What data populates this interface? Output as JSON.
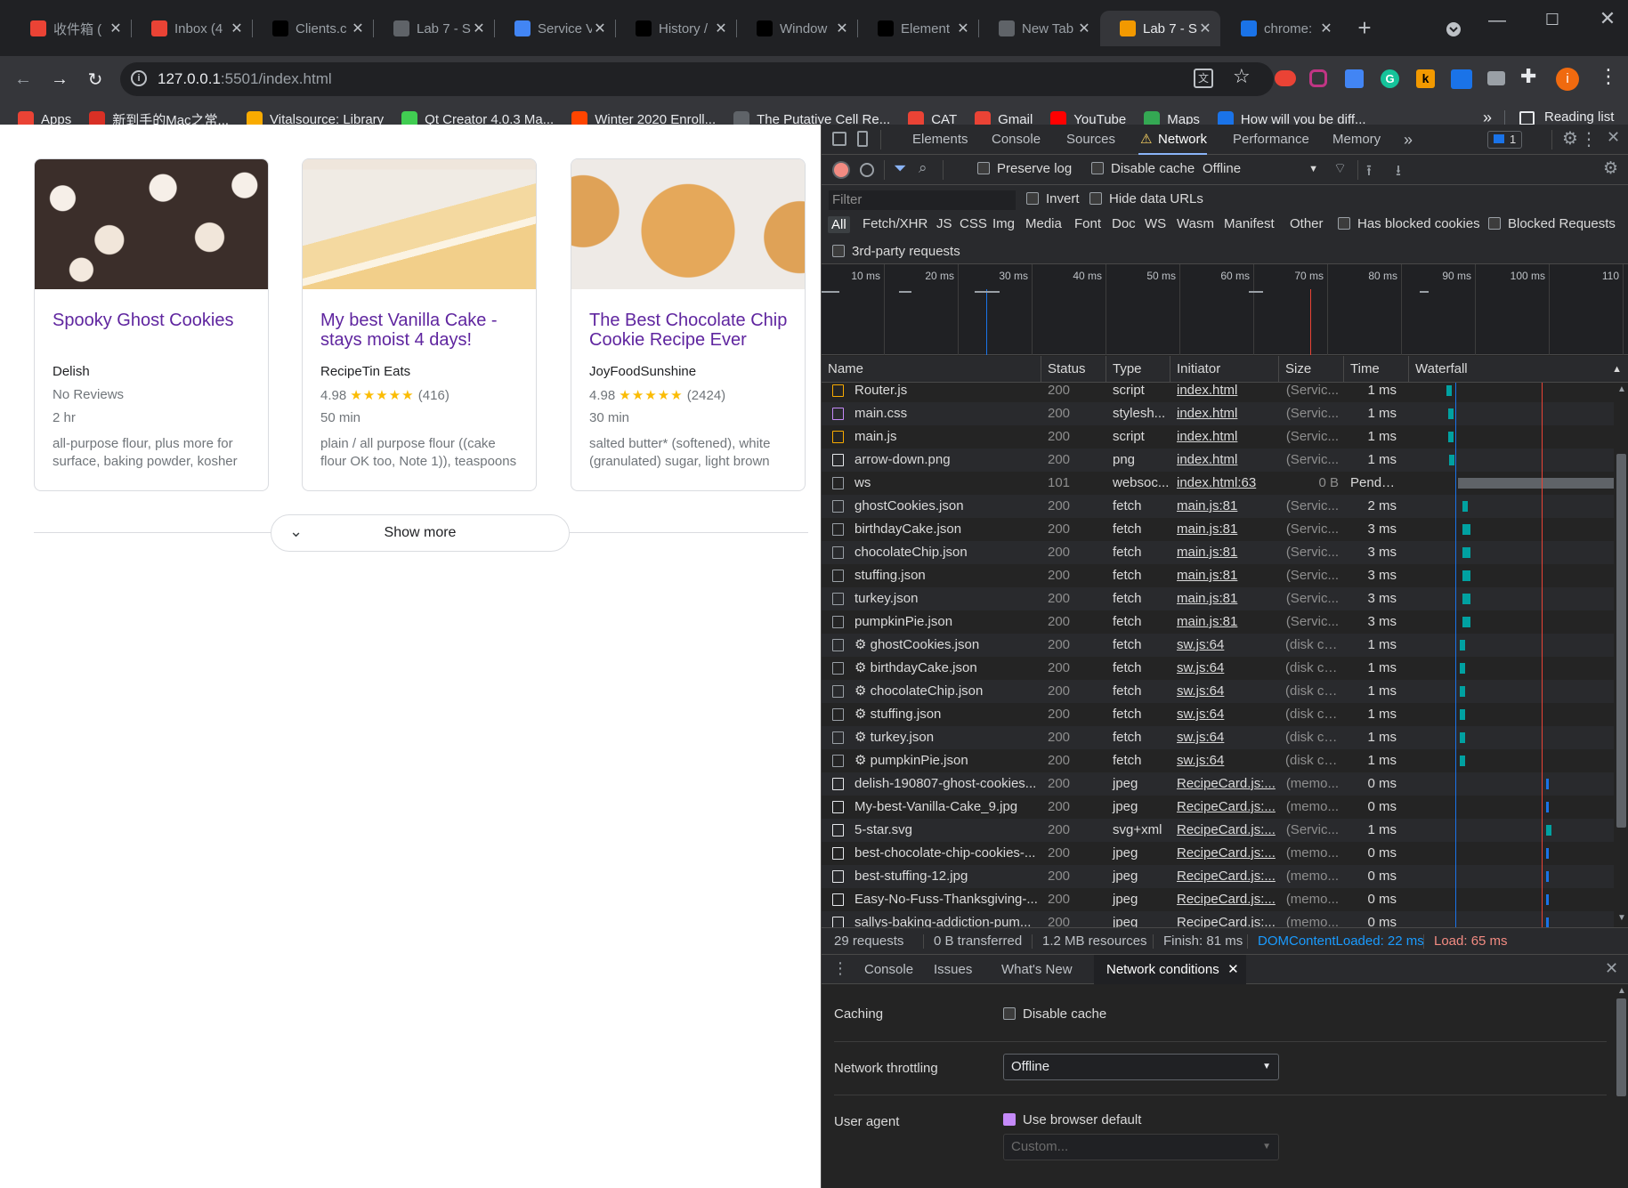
{
  "tabs": [
    {
      "title": "收件箱 (",
      "icon": "gmail-icon",
      "color": "#ea4335"
    },
    {
      "title": "Inbox (4",
      "icon": "gmail-icon",
      "color": "#ea4335"
    },
    {
      "title": "Clients.c",
      "icon": "notion-icon",
      "color": "#000000"
    },
    {
      "title": "Lab 7 - S",
      "icon": "globe-icon",
      "color": "#5f6368"
    },
    {
      "title": "Service V",
      "icon": "google-slides-icon",
      "color": "#4285f4"
    },
    {
      "title": "History /",
      "icon": "notion-icon",
      "color": "#000000"
    },
    {
      "title": "Window",
      "icon": "notion-icon",
      "color": "#000000"
    },
    {
      "title": "Element",
      "icon": "notion-icon",
      "color": "#000000"
    },
    {
      "title": "New Tab",
      "icon": "chrome-icon",
      "color": "#5f6368"
    },
    {
      "title": "Lab 7 - S",
      "icon": "cookie-icon",
      "color": "#f29900",
      "active": true
    },
    {
      "title": "chrome:",
      "icon": "chrome-icon",
      "color": "#1a73e8"
    }
  ],
  "url": {
    "host": "127.0.0.1",
    "rest": ":5501/index.html"
  },
  "bookmarks": [
    {
      "label": "Apps",
      "color": "#ea4335"
    },
    {
      "label": "新到手的Mac之常...",
      "color": "#d93025"
    },
    {
      "label": "Vitalsource: Library",
      "color": "#f9ab00"
    },
    {
      "label": "Qt Creator 4.0.3 Ma...",
      "color": "#41cd52"
    },
    {
      "label": "Winter 2020 Enroll...",
      "color": "#ff4500"
    },
    {
      "label": "The Putative Cell Re...",
      "color": "#5f6368"
    },
    {
      "label": "CAT",
      "color": "#ea4335"
    },
    {
      "label": "Gmail",
      "color": "#ea4335"
    },
    {
      "label": "YouTube",
      "color": "#ff0000"
    },
    {
      "label": "Maps",
      "color": "#34a853"
    },
    {
      "label": "How will you be diff...",
      "color": "#1a73e8"
    }
  ],
  "reading_list": "Reading list",
  "more_bookmarks": "»",
  "cards": [
    {
      "title": "Spooky Ghost Cookies",
      "source": "Delish",
      "rating": "No Reviews",
      "stars": "",
      "count": "",
      "time": "2 hr",
      "ingredients": "all-purpose flour, plus more for surface, baking powder, kosher"
    },
    {
      "title": "My best Vanilla Cake - stays moist 4 days!",
      "source": "RecipeTin Eats",
      "rating": "4.98",
      "stars": "★★★★★",
      "count": "(416)",
      "time": "50 min",
      "ingredients": "plain / all purpose flour ((cake flour OK too, Note 1)), teaspoons"
    },
    {
      "title": "The Best Chocolate Chip Cookie Recipe Ever",
      "source": "JoyFoodSunshine",
      "rating": "4.98",
      "stars": "★★★★★",
      "count": "(2424)",
      "time": "30 min",
      "ingredients": "salted butter* (softened), white (granulated) sugar, light brown"
    }
  ],
  "show_more": "Show more",
  "devtools": {
    "tabs": [
      "Elements",
      "Console",
      "Sources",
      "Network",
      "Performance",
      "Memory"
    ],
    "issues_count": "1",
    "toolbar": {
      "preserve_log": "Preserve log",
      "disable_cache": "Disable cache",
      "throttle": "Offline"
    },
    "filter_placeholder": "Filter",
    "invert": "Invert",
    "hide_data_urls": "Hide data URLs",
    "types": [
      "All",
      "Fetch/XHR",
      "JS",
      "CSS",
      "Img",
      "Media",
      "Font",
      "Doc",
      "WS",
      "Wasm",
      "Manifest",
      "Other"
    ],
    "has_blocked_cookies": "Has blocked cookies",
    "blocked_requests": "Blocked Requests",
    "third_party": "3rd-party requests",
    "ticks": [
      "10 ms",
      "20 ms",
      "30 ms",
      "40 ms",
      "50 ms",
      "60 ms",
      "70 ms",
      "80 ms",
      "90 ms",
      "100 ms",
      "110"
    ],
    "columns": [
      "Name",
      "Status",
      "Type",
      "Initiator",
      "Size",
      "Time",
      "Waterfall"
    ],
    "rows": [
      {
        "name": "Router.js",
        "status": "200",
        "type": "script",
        "init": "index.html",
        "size": "(Servic...",
        "time": "1 ms",
        "icon": "script-icon",
        "wf": 0.05
      },
      {
        "name": "main.css",
        "status": "200",
        "type": "stylesh...",
        "init": "index.html",
        "size": "(Servic...",
        "time": "1 ms",
        "icon": "css-icon",
        "wf": 0.055
      },
      {
        "name": "main.js",
        "status": "200",
        "type": "script",
        "init": "index.html",
        "size": "(Servic...",
        "time": "1 ms",
        "icon": "script-icon",
        "wf": 0.055
      },
      {
        "name": "arrow-down.png",
        "status": "200",
        "type": "png",
        "init": "index.html",
        "size": "(Servic...",
        "time": "1 ms",
        "icon": "image-icon",
        "wf": 0.06
      },
      {
        "name": "ws",
        "status": "101",
        "type": "websoc...",
        "init": "index.html:63",
        "size": "0 B",
        "time": "Pending",
        "icon": "file-icon",
        "wf": 0.1
      },
      {
        "name": "ghostCookies.json",
        "status": "200",
        "type": "fetch",
        "init": "main.js:81",
        "size": "(Servic...",
        "time": "2 ms",
        "icon": "file-icon",
        "wf": 0.12
      },
      {
        "name": "birthdayCake.json",
        "status": "200",
        "type": "fetch",
        "init": "main.js:81",
        "size": "(Servic...",
        "time": "3 ms",
        "icon": "file-icon",
        "wf": 0.12
      },
      {
        "name": "chocolateChip.json",
        "status": "200",
        "type": "fetch",
        "init": "main.js:81",
        "size": "(Servic...",
        "time": "3 ms",
        "icon": "file-icon",
        "wf": 0.12
      },
      {
        "name": "stuffing.json",
        "status": "200",
        "type": "fetch",
        "init": "main.js:81",
        "size": "(Servic...",
        "time": "3 ms",
        "icon": "file-icon",
        "wf": 0.12
      },
      {
        "name": "turkey.json",
        "status": "200",
        "type": "fetch",
        "init": "main.js:81",
        "size": "(Servic...",
        "time": "3 ms",
        "icon": "file-icon",
        "wf": 0.12
      },
      {
        "name": "pumpkinPie.json",
        "status": "200",
        "type": "fetch",
        "init": "main.js:81",
        "size": "(Servic...",
        "time": "3 ms",
        "icon": "file-icon",
        "wf": 0.12
      },
      {
        "name": "⚙ ghostCookies.json",
        "status": "200",
        "type": "fetch",
        "init": "sw.js:64",
        "size": "(disk ca...",
        "time": "1 ms",
        "icon": "file-icon",
        "wf": 0.11
      },
      {
        "name": "⚙ birthdayCake.json",
        "status": "200",
        "type": "fetch",
        "init": "sw.js:64",
        "size": "(disk ca...",
        "time": "1 ms",
        "icon": "file-icon",
        "wf": 0.11
      },
      {
        "name": "⚙ chocolateChip.json",
        "status": "200",
        "type": "fetch",
        "init": "sw.js:64",
        "size": "(disk ca...",
        "time": "1 ms",
        "icon": "file-icon",
        "wf": 0.11
      },
      {
        "name": "⚙ stuffing.json",
        "status": "200",
        "type": "fetch",
        "init": "sw.js:64",
        "size": "(disk ca...",
        "time": "1 ms",
        "icon": "file-icon",
        "wf": 0.11
      },
      {
        "name": "⚙ turkey.json",
        "status": "200",
        "type": "fetch",
        "init": "sw.js:64",
        "size": "(disk ca...",
        "time": "1 ms",
        "icon": "file-icon",
        "wf": 0.11
      },
      {
        "name": "⚙ pumpkinPie.json",
        "status": "200",
        "type": "fetch",
        "init": "sw.js:64",
        "size": "(disk ca...",
        "time": "1 ms",
        "icon": "file-icon",
        "wf": 0.11
      },
      {
        "name": "delish-190807-ghost-cookies...",
        "status": "200",
        "type": "jpeg",
        "init": "RecipeCard.js:...",
        "size": "(memo...",
        "time": "0 ms",
        "icon": "image-icon",
        "wf": 0.5
      },
      {
        "name": "My-best-Vanilla-Cake_9.jpg",
        "status": "200",
        "type": "jpeg",
        "init": "RecipeCard.js:...",
        "size": "(memo...",
        "time": "0 ms",
        "icon": "image-icon",
        "wf": 0.5
      },
      {
        "name": "5-star.svg",
        "status": "200",
        "type": "svg+xml",
        "init": "RecipeCard.js:...",
        "size": "(Servic...",
        "time": "1 ms",
        "icon": "image-icon",
        "wf": 0.5
      },
      {
        "name": "best-chocolate-chip-cookies-...",
        "status": "200",
        "type": "jpeg",
        "init": "RecipeCard.js:...",
        "size": "(memo...",
        "time": "0 ms",
        "icon": "image-icon",
        "wf": 0.5
      },
      {
        "name": "best-stuffing-12.jpg",
        "status": "200",
        "type": "jpeg",
        "init": "RecipeCard.js:...",
        "size": "(memo...",
        "time": "0 ms",
        "icon": "image-icon",
        "wf": 0.5
      },
      {
        "name": "Easy-No-Fuss-Thanksgiving-...",
        "status": "200",
        "type": "jpeg",
        "init": "RecipeCard.js:...",
        "size": "(memo...",
        "time": "0 ms",
        "icon": "image-icon",
        "wf": 0.5
      },
      {
        "name": "sallys-baking-addiction-pum...",
        "status": "200",
        "type": "jpeg",
        "init": "RecipeCard.js:...",
        "size": "(memo...",
        "time": "0 ms",
        "icon": "image-icon",
        "wf": 0.5
      }
    ],
    "summary": {
      "requests": "29 requests",
      "transferred": "0 B transferred",
      "resources": "1.2 MB resources",
      "finish": "Finish: 81 ms",
      "dcl": "DOMContentLoaded: 22 ms",
      "load": "Load: 65 ms"
    },
    "drawer": {
      "tabs": [
        "Console",
        "Issues",
        "What's New",
        "Network conditions"
      ],
      "caching_label": "Caching",
      "disable_cache": "Disable cache",
      "throttling_label": "Network throttling",
      "throttling_value": "Offline",
      "ua_label": "User agent",
      "use_default": "Use browser default",
      "custom_placeholder": "Custom..."
    }
  }
}
